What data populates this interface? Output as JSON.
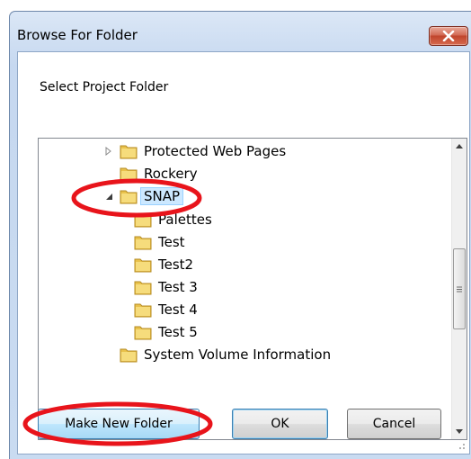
{
  "dialog": {
    "title": "Browse For Folder",
    "prompt": "Select Project Folder"
  },
  "tree": {
    "items": [
      {
        "label": "Protected Web Pages",
        "expander": "collapsed"
      },
      {
        "label": "Rockery",
        "expander": "none"
      },
      {
        "label": "SNAP",
        "expander": "expanded",
        "selected": true
      },
      {
        "label": "Palettes",
        "expander": "none"
      },
      {
        "label": "Test",
        "expander": "none"
      },
      {
        "label": "Test2",
        "expander": "none"
      },
      {
        "label": "Test 3",
        "expander": "none"
      },
      {
        "label": "Test 4",
        "expander": "none"
      },
      {
        "label": "Test 5",
        "expander": "none"
      },
      {
        "label": "System Volume Information",
        "expander": "none"
      }
    ]
  },
  "buttons": {
    "make_new_folder": "Make New Folder",
    "ok": "OK",
    "cancel": "Cancel"
  },
  "icons": {
    "close": "close-icon",
    "folder": "folder-icon",
    "scroll_up": "scroll-up-arrow-icon",
    "scroll_down": "scroll-down-arrow-icon"
  },
  "colors": {
    "annotation": "#e8141b",
    "selection": "#cce8ff",
    "folder": "#e9c24c"
  }
}
